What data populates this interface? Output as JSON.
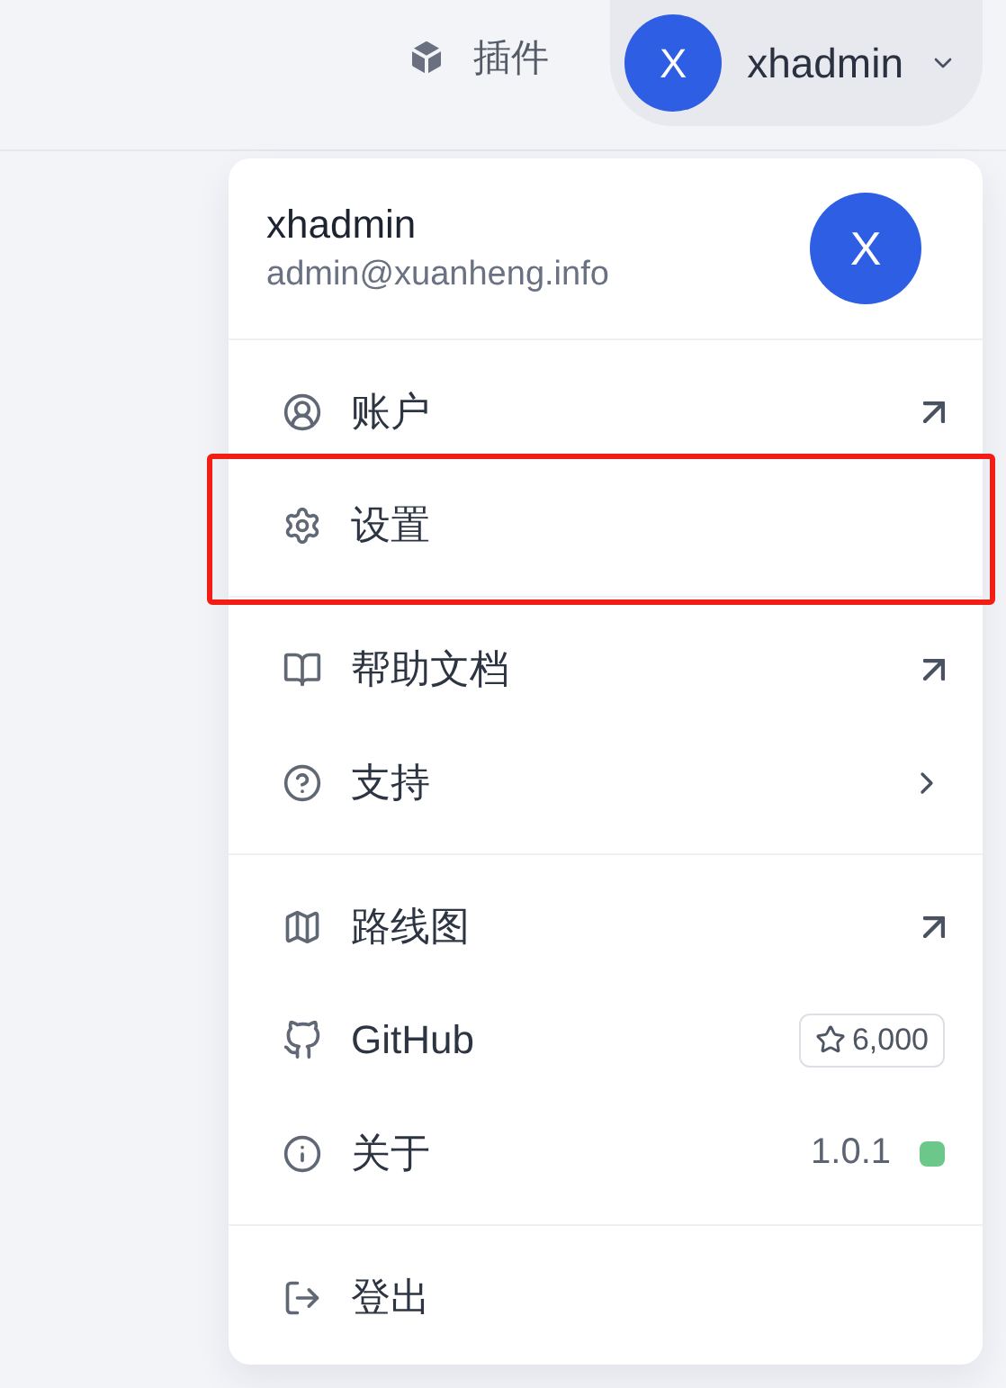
{
  "topbar": {
    "plugins": {
      "label": "插件"
    },
    "user": {
      "avatar": "X",
      "name": "xhadmin"
    }
  },
  "menu": {
    "header": {
      "name": "xhadmin",
      "email": "admin@xuanheng.info",
      "avatar": "X"
    },
    "groups": [
      [
        {
          "label": "账户",
          "trailing": {
            "kind": "external"
          },
          "highlighted": false
        },
        {
          "label": "设置",
          "highlighted": true
        }
      ],
      [
        {
          "label": "帮助文档",
          "trailing": {
            "kind": "external"
          },
          "highlighted": false
        },
        {
          "label": "支持",
          "trailing": {
            "kind": "chevron"
          },
          "highlighted": false
        }
      ],
      [
        {
          "label": "路线图",
          "trailing": {
            "kind": "external"
          },
          "highlighted": false
        },
        {
          "label": "GitHub",
          "trailing": {
            "kind": "stars",
            "text": "6,000"
          },
          "highlighted": false
        },
        {
          "label": "关于",
          "trailing": {
            "kind": "version",
            "text": "1.0.1",
            "color": "#6cc88a"
          },
          "highlighted": false
        }
      ],
      [
        {
          "label": "登出",
          "highlighted": false
        }
      ]
    ]
  }
}
